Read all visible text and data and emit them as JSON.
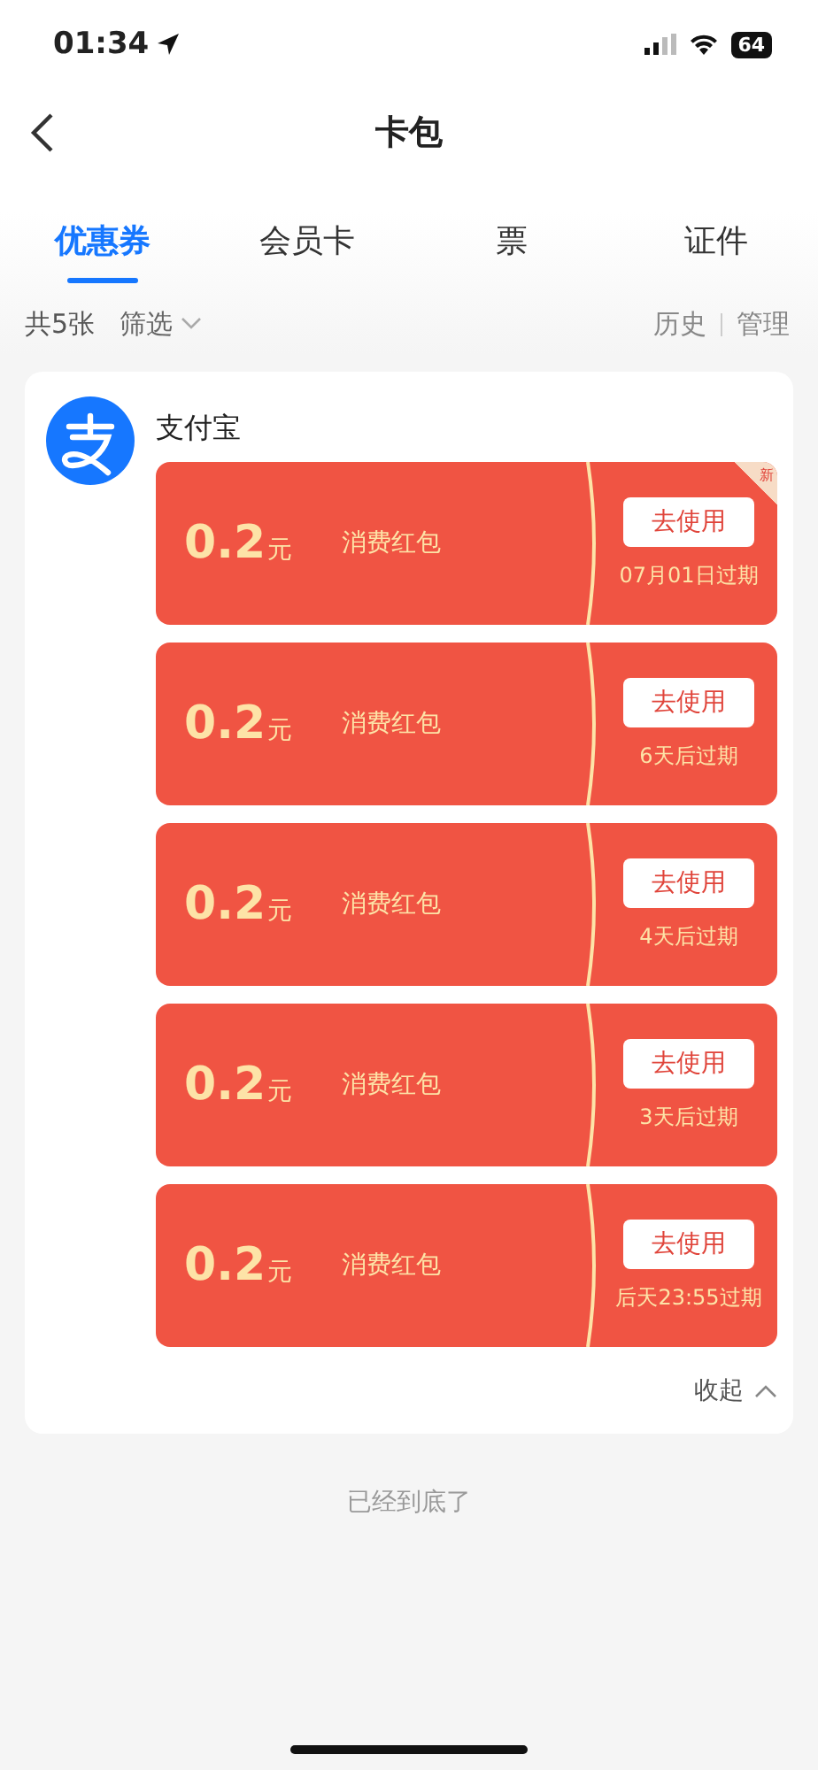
{
  "status_bar": {
    "time": "01:34",
    "battery": "64"
  },
  "nav": {
    "title": "卡包"
  },
  "tabs": [
    {
      "label": "优惠券",
      "selected": true
    },
    {
      "label": "会员卡",
      "selected": false
    },
    {
      "label": "票",
      "selected": false
    },
    {
      "label": "证件",
      "selected": false
    }
  ],
  "toolbar": {
    "count": "共5张",
    "filter": "筛选",
    "history": "历史",
    "manage": "管理"
  },
  "group": {
    "name": "支付宝",
    "collapse": "收起",
    "coupons": [
      {
        "amount": "0.2",
        "unit": "元",
        "name": "消费红包",
        "action": "去使用",
        "expiry": "07月01日过期",
        "badge": "新"
      },
      {
        "amount": "0.2",
        "unit": "元",
        "name": "消费红包",
        "action": "去使用",
        "expiry": "6天后过期"
      },
      {
        "amount": "0.2",
        "unit": "元",
        "name": "消费红包",
        "action": "去使用",
        "expiry": "4天后过期"
      },
      {
        "amount": "0.2",
        "unit": "元",
        "name": "消费红包",
        "action": "去使用",
        "expiry": "3天后过期"
      },
      {
        "amount": "0.2",
        "unit": "元",
        "name": "消费红包",
        "action": "去使用",
        "expiry": "后天23:55过期"
      }
    ]
  },
  "footer": "已经到底了"
}
